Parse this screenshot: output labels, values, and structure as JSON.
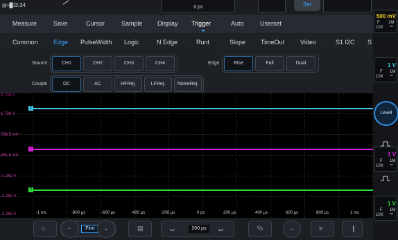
{
  "status": {
    "time": "03:34",
    "time_offset": "0 ps",
    "set_label": "Set"
  },
  "menu": [
    {
      "label": "Measure"
    },
    {
      "label": "Save"
    },
    {
      "label": "Cursor"
    },
    {
      "label": "Sample"
    },
    {
      "label": "Display"
    },
    {
      "label": "Trigger"
    },
    {
      "label": "Auto"
    },
    {
      "label": "Userset"
    }
  ],
  "trigger_types": [
    {
      "label": "Common"
    },
    {
      "label": "Edge"
    },
    {
      "label": "PulseWidth"
    },
    {
      "label": "Logic"
    },
    {
      "label": "N Edge"
    },
    {
      "label": "Runt"
    },
    {
      "label": "Slope"
    },
    {
      "label": "TimeOut"
    },
    {
      "label": "Video"
    },
    {
      "label": "S1 I2C"
    },
    {
      "label": "S"
    }
  ],
  "settings": {
    "source_label": "Source",
    "sources": [
      "CH1",
      "CH2",
      "CH3",
      "CH4"
    ],
    "source_selected": "CH1",
    "edge_label": "Edge",
    "edges": [
      "Rise",
      "Fall",
      "Dual"
    ],
    "edge_selected": "Rise",
    "couple_label": "Couple",
    "couples": [
      "DC",
      "AC",
      "HFRej.",
      "LFRej.",
      "NoiseRej."
    ],
    "couple_selected": "DC"
  },
  "scope": {
    "y_labels": [
      {
        "text": "2.738 V",
        "color": "#b0208a"
      },
      {
        "text": "1.738 V",
        "color": "#d040b0"
      },
      {
        "text": "738.5 mV",
        "color": "#d040b0"
      },
      {
        "text": "261.5 mV",
        "color": "#d040b0"
      },
      {
        "text": "-1.262 V",
        "color": "#d040b0"
      },
      {
        "text": "-2.262 V",
        "color": "#d040b0"
      },
      {
        "text": "-3.262 V",
        "color": "#d040b0"
      }
    ],
    "x_labels": [
      "-1 ms",
      "-800 µs",
      "-600 µs",
      "-400 µs",
      "-200 µs",
      "0 ps",
      "200 µs",
      "400 µs",
      "600 µs",
      "800 µs",
      "1 ms"
    ],
    "traces": [
      {
        "marker": "2",
        "color": "#3fc8e8"
      },
      {
        "marker": "1",
        "color": "#e020e0"
      },
      {
        "marker": "3",
        "color": "#2edc3c"
      }
    ]
  },
  "right_panel": {
    "channels": [
      {
        "volt": "500 mV",
        "coupling": "F",
        "probe": "10X",
        "impedance": "1M",
        "color": "#f0d020"
      },
      {
        "volt": "1 V",
        "coupling": "F",
        "probe": "10X",
        "impedance": "1M",
        "color": "#3fc8e8"
      },
      {
        "volt": "1 V",
        "coupling": "F",
        "probe": "10X",
        "impedance": "1M",
        "color": "#e020e0"
      },
      {
        "volt": "1 V",
        "coupling": "F",
        "probe": "10X",
        "impedance": "1M",
        "color": "#2edc3c"
      }
    ],
    "level_label": "Level"
  },
  "toolbar": {
    "fine_label": "Fine",
    "timebase_value": "200 µs"
  }
}
